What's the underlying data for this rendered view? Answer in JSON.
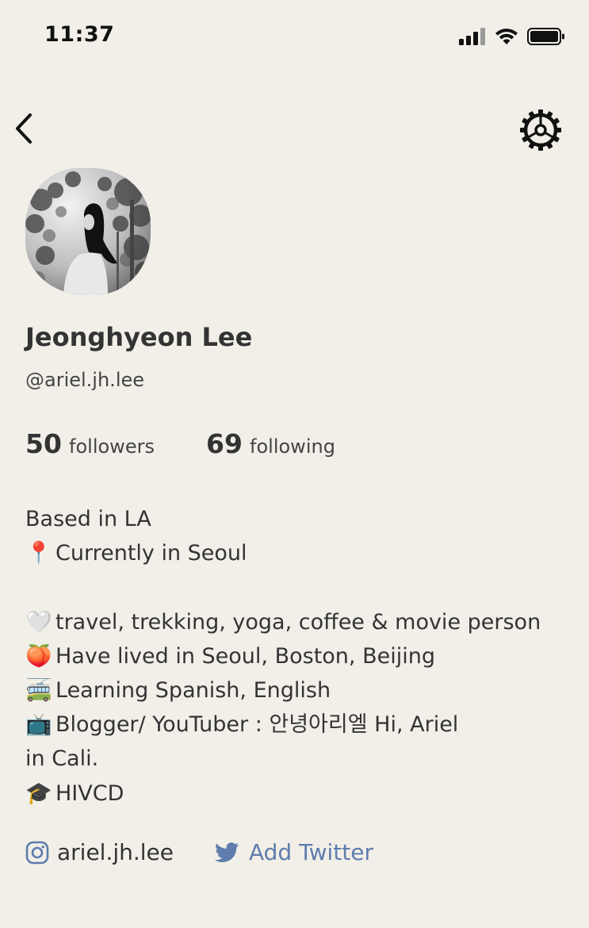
{
  "status_bar": {
    "time": "11:37",
    "icons": [
      "signal-icon",
      "wifi-icon",
      "battery-icon"
    ]
  },
  "nav": {
    "back_icon": "chevron-left-icon",
    "settings_icon": "gear-icon"
  },
  "profile": {
    "name": "Jeonghyeon Lee",
    "handle": "@ariel.jh.lee",
    "followers_count": "50",
    "followers_label": "followers",
    "following_count": "69",
    "following_label": "following"
  },
  "bio": {
    "lines": [
      {
        "emoji": "",
        "text": "Based in LA"
      },
      {
        "emoji": "📍",
        "text": "Currently in Seoul"
      },
      {
        "emoji": "",
        "text": ""
      },
      {
        "emoji": "🤍",
        "text": "travel, trekking, yoga, coffee & movie person"
      },
      {
        "emoji": "🍑",
        "text": "Have lived in Seoul, Boston, Beijing"
      },
      {
        "emoji": "🚎",
        "text": "Learning Spanish, English"
      },
      {
        "emoji": "📺",
        "text": "Blogger/ YouTuber : 안녕아리엘 Hi, Ariel"
      },
      {
        "emoji": "",
        "text": "in Cali."
      },
      {
        "emoji": "🎓",
        "text": "HIVCD"
      }
    ]
  },
  "links": {
    "instagram_icon": "instagram-icon",
    "instagram_handle": "ariel.jh.lee",
    "twitter_icon": "twitter-icon",
    "twitter_label": "Add Twitter"
  },
  "colors": {
    "background": "#f1efe8",
    "text": "#333333",
    "link_blue": "#5e7cad"
  }
}
